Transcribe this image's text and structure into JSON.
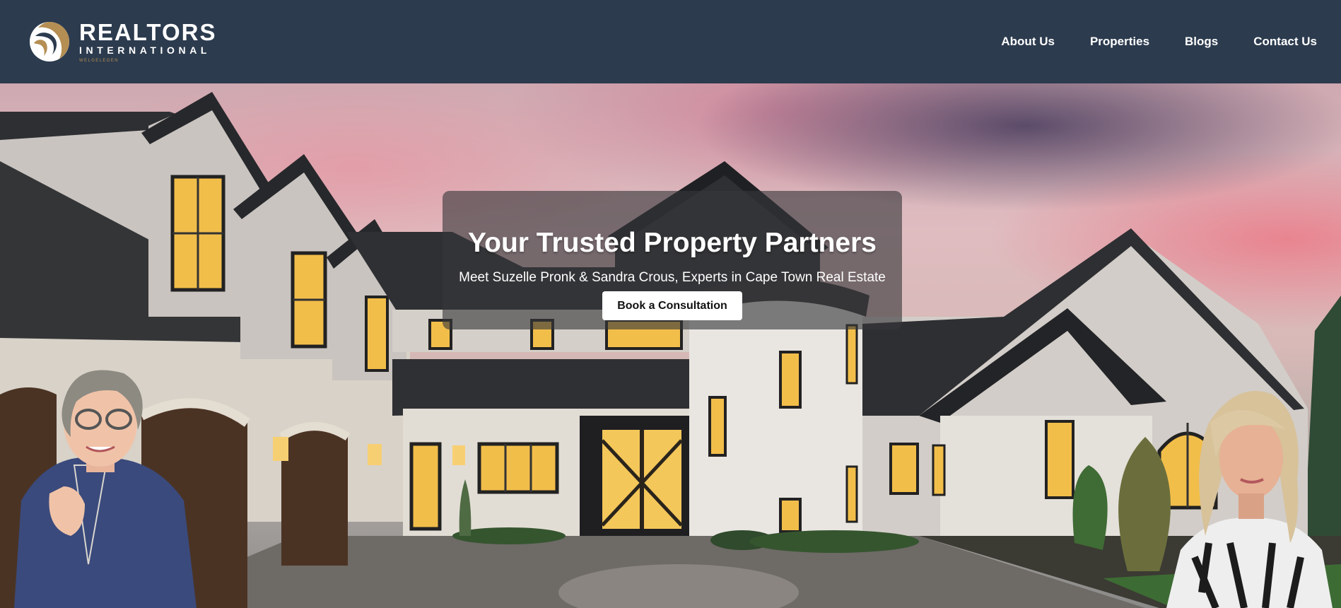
{
  "brand": {
    "name": "REALTORS",
    "sub": "INTERNATIONAL",
    "tagline": "WELGELEGEN",
    "logo_icon": "realtors-swirl-logo",
    "gold": "#b58e53"
  },
  "nav": {
    "items": [
      {
        "label": "About Us"
      },
      {
        "label": "Properties"
      },
      {
        "label": "Blogs"
      },
      {
        "label": "Contact Us"
      }
    ]
  },
  "hero": {
    "title": "Your Trusted Property Partners",
    "subtitle": "Meet Suzelle Pronk & Sandra Crous, Experts in Cape Town Real Estate",
    "cta_label": "Book a Consultation",
    "background": "luxury-house-at-sunset",
    "header_bg": "#2c3b4e"
  }
}
